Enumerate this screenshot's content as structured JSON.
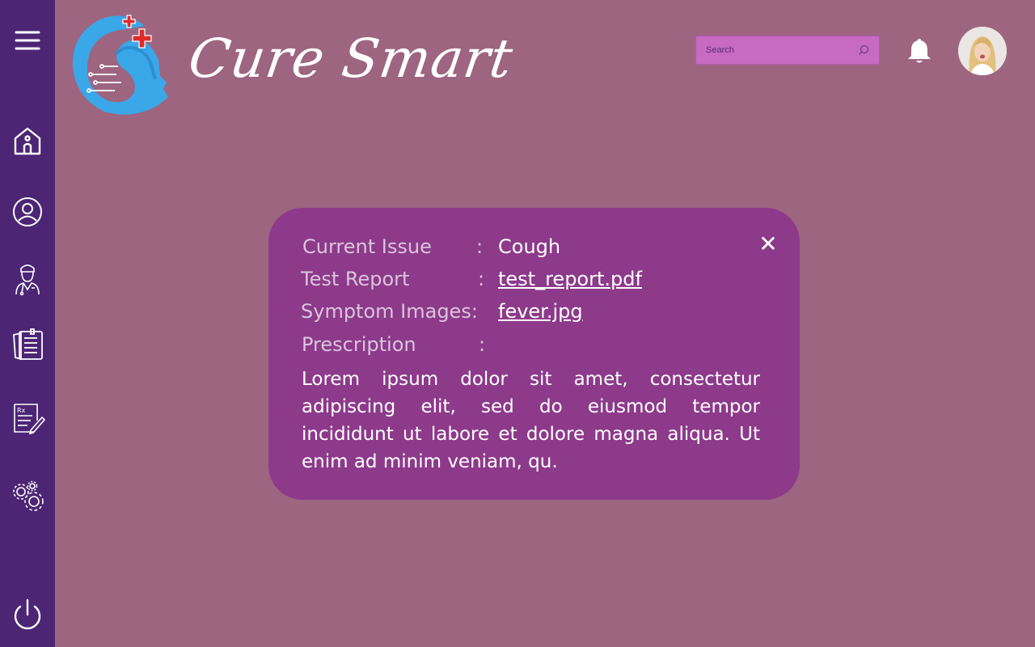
{
  "app": {
    "brand_name": "Cure Smart",
    "accent_color": "#c66ac2",
    "sidebar_color": "#4d2575",
    "background_color": "#9d6580",
    "modal_color": "#8d3a8b"
  },
  "sidebar": {
    "items": [
      {
        "icon": "menu-icon"
      },
      {
        "icon": "home-icon"
      },
      {
        "icon": "profile-icon"
      },
      {
        "icon": "doctor-icon"
      },
      {
        "icon": "records-icon"
      },
      {
        "icon": "prescription-icon"
      },
      {
        "icon": "settings-icon"
      },
      {
        "icon": "power-icon"
      }
    ]
  },
  "header": {
    "search": {
      "placeholder": "Search"
    },
    "notification_icon": "bell-icon",
    "avatar_icon": "user-avatar"
  },
  "modal": {
    "fields": [
      {
        "label": "Current Issue",
        "colon": ":",
        "value": "Cough"
      },
      {
        "label": "Test Report",
        "colon": ":",
        "value": "test_report.pdf"
      },
      {
        "label": "Symptom Images:",
        "colon": "",
        "value": "fever.jpg"
      },
      {
        "label": "Prescription",
        "colon": ":",
        "value": ""
      }
    ],
    "prescription_text": "Lorem ipsum dolor sit amet, consectetur adipiscing elit, sed do eiusmod tempor incididunt ut labore et dolore magna aliqua. Ut enim ad minim veniam, qu.",
    "close_icon": "close-icon"
  }
}
